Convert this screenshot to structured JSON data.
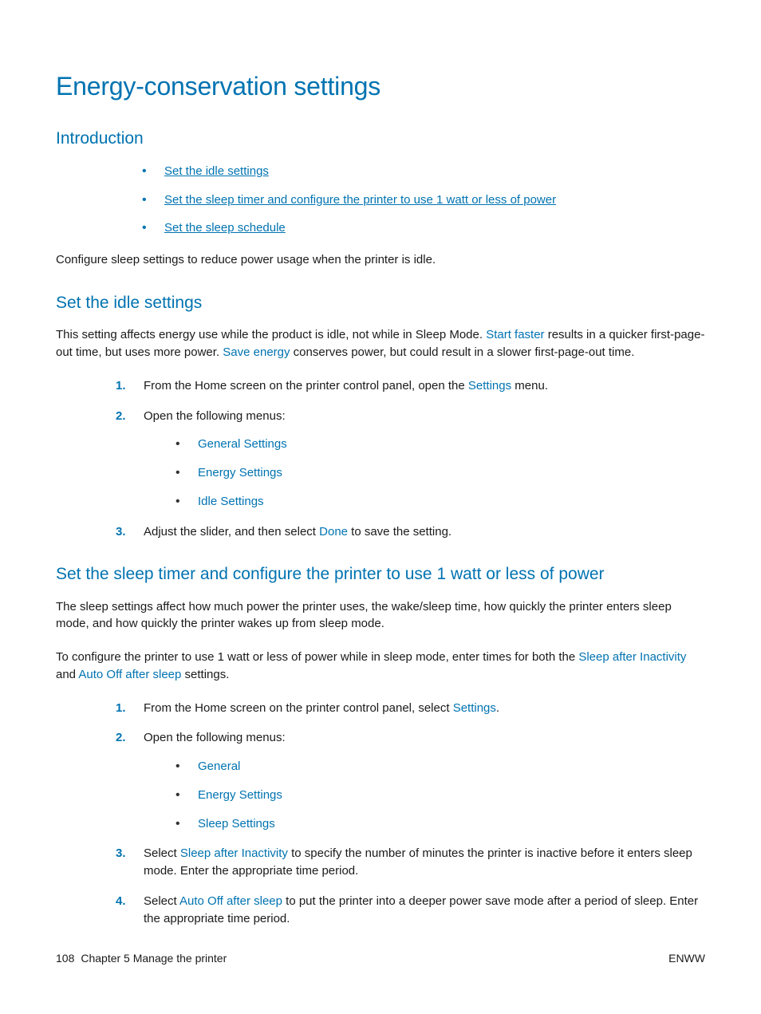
{
  "title": "Energy-conservation settings",
  "intro": {
    "heading": "Introduction",
    "toc": [
      "Set the idle settings",
      "Set the sleep timer and configure the printer to use 1 watt or less of power",
      "Set the sleep schedule"
    ],
    "body": "Configure sleep settings to reduce power usage when the printer is idle."
  },
  "idle": {
    "heading": "Set the idle settings",
    "para": {
      "t1": "This setting affects energy use while the product is idle, not while in Sleep Mode. ",
      "u1": "Start faster",
      "t2": " results in a quicker first-page-out time, but uses more power. ",
      "u2": "Save energy",
      "t3": " conserves power, but could result in a slower first-page-out time."
    },
    "steps": {
      "s1a": "From the Home screen on the printer control panel, open the ",
      "s1u": "Settings",
      "s1b": " menu.",
      "s2": "Open the following menus:",
      "menus": [
        "General Settings",
        "Energy Settings",
        "Idle Settings"
      ],
      "s3a": "Adjust the slider, and then select ",
      "s3u": "Done",
      "s3b": " to save the setting."
    }
  },
  "sleep": {
    "heading": "Set the sleep timer and configure the printer to use 1 watt or less of power",
    "p1": "The sleep settings affect how much power the printer uses, the wake/sleep time, how quickly the printer enters sleep mode, and how quickly the printer wakes up from sleep mode.",
    "p2": {
      "a": "To configure the printer to use 1 watt or less of power while in sleep mode, enter times for both the ",
      "u1": "Sleep after Inactivity",
      "b": " and ",
      "u2": "Auto Off after sleep",
      "c": " settings."
    },
    "steps": {
      "s1a": "From the Home screen on the printer control panel, select ",
      "s1u": "Settings",
      "s1b": ".",
      "s2": "Open the following menus:",
      "menus": [
        "General",
        "Energy Settings",
        "Sleep Settings"
      ],
      "s3a": "Select ",
      "s3u": "Sleep after Inactivity",
      "s3b": " to specify the number of minutes the printer is inactive before it enters sleep mode. Enter the appropriate time period.",
      "s4a": "Select ",
      "s4u": "Auto Off after sleep",
      "s4b": " to put the printer into a deeper power save mode after a period of sleep. Enter the appropriate time period."
    }
  },
  "footer": {
    "page": "108",
    "chapter": "Chapter 5   Manage the printer",
    "right": "ENWW"
  }
}
